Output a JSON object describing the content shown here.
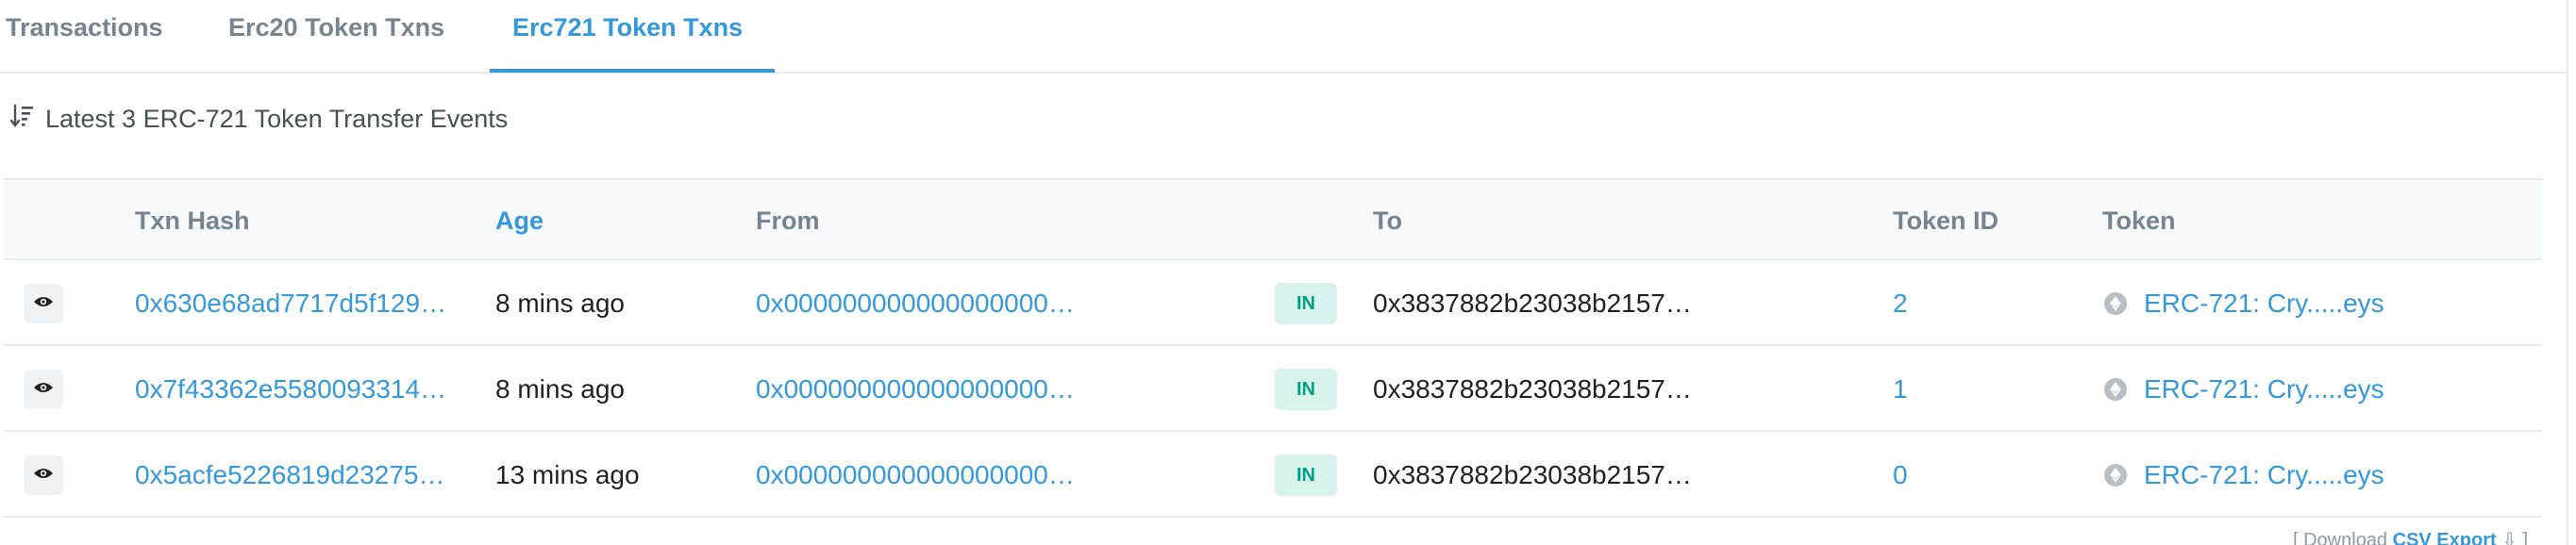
{
  "tabs": [
    {
      "label": "Transactions",
      "active": false
    },
    {
      "label": "Erc20 Token Txns",
      "active": false
    },
    {
      "label": "Erc721 Token Txns",
      "active": true
    }
  ],
  "summary": {
    "text": "Latest 3 ERC-721 Token Transfer Events",
    "icon": "sort-desc-icon"
  },
  "table": {
    "columns": {
      "txn_hash": "Txn Hash",
      "age": "Age",
      "from": "From",
      "to": "To",
      "token_id": "Token ID",
      "token": "Token"
    },
    "rows": [
      {
        "txn_hash": "0x630e68ad7717d5f129…",
        "age": "8 mins ago",
        "from": "0x000000000000000000…",
        "direction": "IN",
        "to": "0x3837882b23038b2157…",
        "token_id": "2",
        "token": "ERC-721: Cry.....eys"
      },
      {
        "txn_hash": "0x7f43362e5580093314…",
        "age": "8 mins ago",
        "from": "0x000000000000000000…",
        "direction": "IN",
        "to": "0x3837882b23038b2157…",
        "token_id": "1",
        "token": "ERC-721: Cry.....eys"
      },
      {
        "txn_hash": "0x5acfe5226819d23275…",
        "age": "13 mins ago",
        "from": "0x000000000000000000…",
        "direction": "IN",
        "to": "0x3837882b23038b2157…",
        "token_id": "0",
        "token": "ERC-721: Cry.....eys"
      }
    ]
  },
  "footer": {
    "prefix": "[ Download ",
    "csv_label": "CSV Export",
    "suffix": " ]"
  },
  "colors": {
    "accent": "#3498db",
    "in_badge_bg": "#d8f3ec",
    "in_badge_text": "#00a186"
  }
}
